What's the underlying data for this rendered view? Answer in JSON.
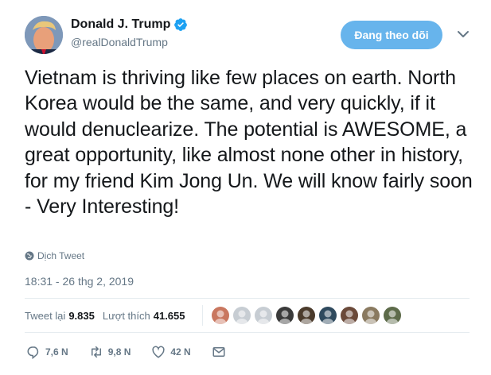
{
  "author": {
    "display_name": "Donald J. Trump",
    "handle": "@realDonaldTrump",
    "verified": true
  },
  "follow_button": {
    "label": "Đang theo dõi"
  },
  "tweet": {
    "text": "Vietnam is thriving like few places on earth. North Korea would be the same, and very quickly, if it would denuclearize. The potential is AWESOME, a great opportunity, like almost none other in history, for my friend Kim Jong Un. We will know fairly soon - Very Interesting!",
    "translate_label": "Dịch Tweet",
    "timestamp": "18:31 - 26 thg 2, 2019"
  },
  "stats": {
    "retweets_label": "Tweet lại",
    "retweets_value": "9.835",
    "likes_label": "Lượt thích",
    "likes_value": "41.655"
  },
  "likers": [
    {
      "name": "liker-1",
      "color": "#c9775f"
    },
    {
      "name": "liker-2",
      "color": "#c7cdd3"
    },
    {
      "name": "liker-3",
      "color": "#c7cdd3"
    },
    {
      "name": "liker-4",
      "color": "#3a3a3a"
    },
    {
      "name": "liker-5",
      "color": "#4b3b2c"
    },
    {
      "name": "liker-6",
      "color": "#2f4a5e"
    },
    {
      "name": "liker-7",
      "color": "#6b4a3a"
    },
    {
      "name": "liker-8",
      "color": "#8a7a60"
    },
    {
      "name": "liker-9",
      "color": "#5d6b4a"
    }
  ],
  "actions": {
    "reply_count": "7,6 N",
    "retweet_count": "9,8 N",
    "like_count": "42 N"
  },
  "icons": {
    "verified": "verified-badge-icon",
    "caret": "chevron-down-icon",
    "translate": "globe-icon",
    "reply": "reply-icon",
    "retweet": "retweet-icon",
    "like": "heart-icon",
    "dm": "envelope-icon"
  },
  "colors": {
    "accent": "#1da1f2",
    "follow_button": "#67b4ec",
    "secondary_text": "#657786",
    "divider": "#e6ecf0"
  }
}
